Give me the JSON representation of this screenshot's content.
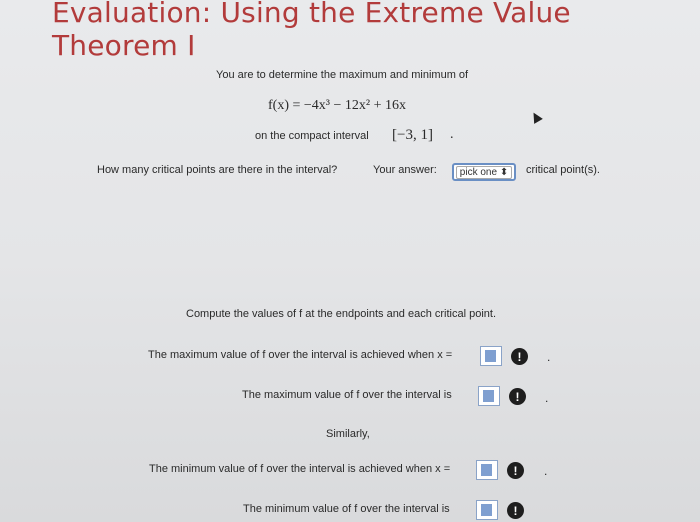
{
  "title": "Evaluation: Using the Extreme Value Theorem I",
  "intro": "You are to determine the maximum and minimum of",
  "function_expr": "f(x) = −4x³ − 12x² + 16x",
  "interval_label": "on the compact interval",
  "interval": "[−3, 1]",
  "interval_end": ".",
  "question_critical": "How many critical points are there in the interval?",
  "your_answer_label": "Your answer:",
  "dropdown_value": "pick one ⬍",
  "critical_suffix": "critical point(s).",
  "compute_text": "Compute the values of f at the endpoints and each critical point.",
  "max_at_text": "The maximum value of f over the interval is achieved when x =",
  "max_val_text": "The maximum value of f over the interval is",
  "similarly": "Similarly,",
  "min_at_text": "The minimum value of f over the interval is achieved when x =",
  "min_val_text": "The minimum value of f over the interval is",
  "warning_glyph": "!",
  "period": "."
}
